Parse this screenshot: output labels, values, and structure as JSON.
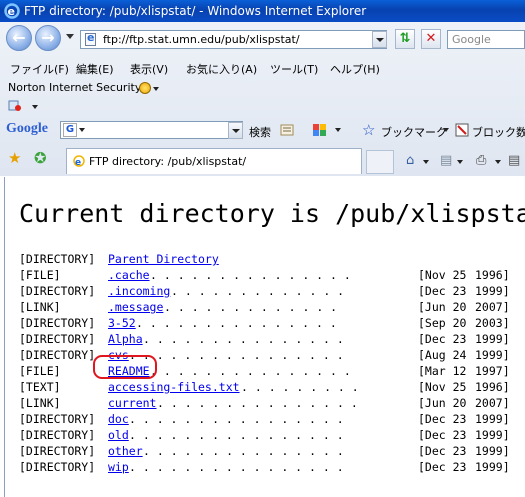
{
  "window": {
    "title": "FTP directory: /pub/xlispstat/ - Windows Internet Explorer"
  },
  "toolbar": {
    "address": "ftp://ftp.stat.umn.edu/pub/xlispstat/",
    "search_placeholder": "Google"
  },
  "menu": {
    "items": [
      "ファイル(F)",
      "編集(E)",
      "表示(V)",
      "お気に入り(A)",
      "ツール(T)",
      "ヘルプ(H)"
    ]
  },
  "norton": {
    "label": "Norton Internet Security"
  },
  "google_toolbar": {
    "logo": "Google",
    "search_label": "検索",
    "bookmarks_label": "ブックマーク",
    "popup_label": "ブロック数:"
  },
  "tab": {
    "label": "FTP directory: /pub/xlispstat/"
  },
  "page": {
    "heading": "Current directory is /pub/xlispstat/",
    "entries": [
      {
        "kind": "[DIRECTORY]",
        "name": "Parent Directory",
        "dots": "",
        "date": "",
        "year": ""
      },
      {
        "kind": "[FILE]",
        "name": ".cache",
        "dots": ". . . . . . . . . . . . . . .",
        "date": "[Nov 25",
        "year": "1996]"
      },
      {
        "kind": "[DIRECTORY]",
        "name": ".incoming",
        "dots": ". . . . . . . . . . . . .",
        "date": "[Dec 23",
        "year": "1999]"
      },
      {
        "kind": "[LINK]",
        "name": ".message",
        "dots": ". . . . . . . . . . . . .",
        "date": "[Jun 20",
        "year": "2007]"
      },
      {
        "kind": "[DIRECTORY]",
        "name": "3-52",
        "dots": ". . . . . . . . . . . . . . .",
        "date": "[Sep 20",
        "year": "2003]"
      },
      {
        "kind": "[DIRECTORY]",
        "name": "Alpha",
        "dots": ". . . . . . . . . . . . . . .",
        "date": "[Dec 23",
        "year": "1999]"
      },
      {
        "kind": "[DIRECTORY]",
        "name": "cvs",
        "dots": ". . . . . . . . . . . . . . . .",
        "date": "[Aug 24",
        "year": "1999]"
      },
      {
        "kind": "[FILE]",
        "name": "README",
        "dots": ". . . . . . . . . . . . . . .",
        "date": "[Mar 12",
        "year": "1997]"
      },
      {
        "kind": "[TEXT]",
        "name": "accessing-files.txt",
        "dots": ". . . . . . . . .",
        "date": "[Nov 25",
        "year": "1996]"
      },
      {
        "kind": "[LINK]",
        "name": "current",
        "dots": ". . . . . . . . . . . . . . .",
        "date": "[Jun 20",
        "year": "2007]"
      },
      {
        "kind": "[DIRECTORY]",
        "name": "doc",
        "dots": ". . . . . . . . . . . . . . . .",
        "date": "[Dec 23",
        "year": "1999]"
      },
      {
        "kind": "[DIRECTORY]",
        "name": "old",
        "dots": ". . . . . . . . . . . . . . . .",
        "date": "[Dec 23",
        "year": "1999]"
      },
      {
        "kind": "[DIRECTORY]",
        "name": "other",
        "dots": ". . . . . . . . . . . . . . .",
        "date": "[Dec 23",
        "year": "1999]"
      },
      {
        "kind": "[DIRECTORY]",
        "name": "wip",
        "dots": ". . . . . . . . . . . . . . . .",
        "date": "[Dec 23",
        "year": "1999]"
      }
    ]
  },
  "annotation": {
    "color": "#e0161f"
  }
}
